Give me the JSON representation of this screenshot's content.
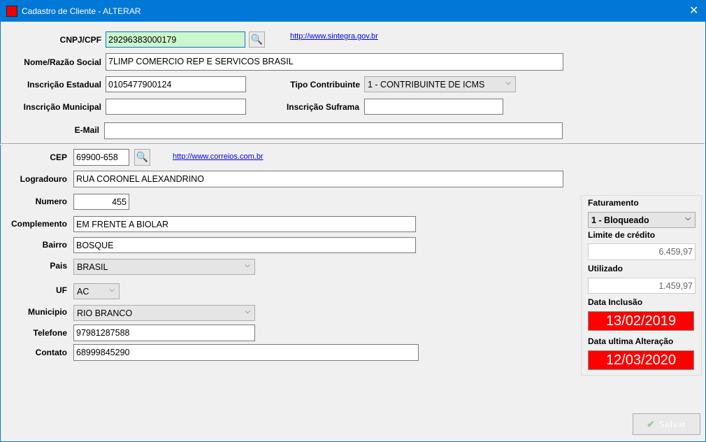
{
  "window": {
    "title": "Cadastro de Cliente - ALTERAR"
  },
  "labels": {
    "cnpj": "CNPJ/CPF",
    "nome": "Nome/Razão Social",
    "ie": "Inscrição Estadual",
    "tipo": "Tipo Contribuinte",
    "im": "Inscrição Municipal",
    "suframa": "Inscrição Suframa",
    "email": "E-Mail",
    "cep": "CEP",
    "logradouro": "Logradouro",
    "numero": "Numero",
    "complemento": "Complemento",
    "bairro": "Bairro",
    "pais": "Pais",
    "uf": "UF",
    "municipio": "Municipio",
    "telefone": "Telefone",
    "contato": "Contato"
  },
  "values": {
    "cnpj": "29296383000179",
    "nome": "7LIMP COMERCIO REP E SERVICOS BRASIL",
    "ie": "0105477900124",
    "tipo": "1 - CONTRIBUINTE DE ICMS",
    "im": "",
    "suframa": "",
    "email": "",
    "cep": "69900-658",
    "logradouro": "RUA CORONEL ALEXANDRINO",
    "numero": "455",
    "complemento": "EM FRENTE A BIOLAR",
    "bairro": "BOSQUE",
    "pais": "BRASIL",
    "uf": "AC",
    "municipio": "RIO BRANCO",
    "telefone": "97981287588",
    "contato": "68999845290"
  },
  "links": {
    "sintegra": "http://www.sintegra.gov.br",
    "correios": "http://www.correios.com.br"
  },
  "panel": {
    "faturamento_label": "Faturamento",
    "faturamento": "1 - Bloqueado",
    "limite_label": "Limite de crédito",
    "limite": "6.459,97",
    "utilizado_label": "Utilizado",
    "utilizado": "1.459,97",
    "inclusao_label": "Data Inclusão",
    "inclusao": "13/02/2019",
    "alteracao_label": "Data ultima Alteração",
    "alteracao": "12/03/2020"
  },
  "buttons": {
    "salvar": "Salvar"
  },
  "colors": {
    "titlebar": "#0078d7",
    "highlight_input": "#ccf7cc",
    "date_bg": "#ff0000"
  }
}
